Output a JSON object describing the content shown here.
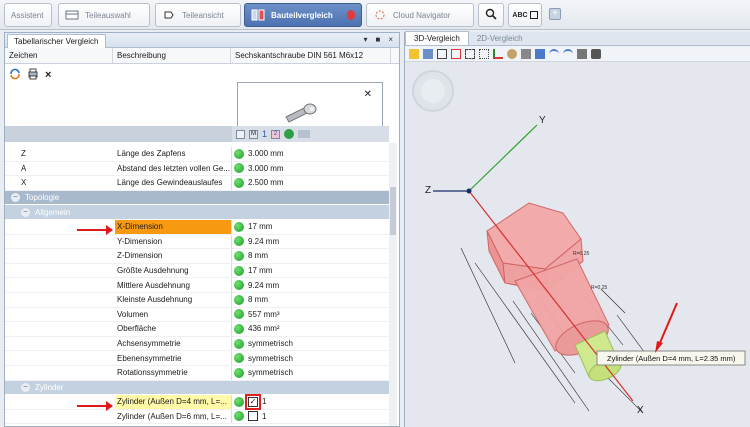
{
  "tabs": [
    {
      "label": "Assistent",
      "icon": "wizard-icon"
    },
    {
      "label": "Teileauswahl",
      "icon": "parts-selection-icon"
    },
    {
      "label": "Teileansicht",
      "icon": "parts-view-icon"
    },
    {
      "label": "Bauteilvergleich",
      "icon": "part-compare-icon",
      "active": true
    },
    {
      "label": "Cloud Navigator",
      "icon": "cloud-navigator-icon"
    }
  ],
  "toolbar": {
    "abc_label": "ABC"
  },
  "left_panel": {
    "title": "Tabellarischer Vergleich",
    "columns": {
      "sign": "Zeichen",
      "description": "Beschreibung",
      "part": "Sechskantschraube DIN 561 M6x12"
    },
    "grid_toolbar": {
      "num1": "1",
      "num2": "2",
      "m_label": "M"
    },
    "rows_top": [
      {
        "sign": "Z",
        "desc": "Länge des Zapfens",
        "value": "3.000 mm"
      },
      {
        "sign": "A",
        "desc": "Abstand des letzten vollen Ge...",
        "value": "3.000 mm"
      },
      {
        "sign": "X",
        "desc": "Länge des Gewindeauslaufes",
        "value": "2.500 mm"
      }
    ],
    "group_topologie": "Topologie",
    "subgroup_allgemein": "Allgemein",
    "rows_allgemein": [
      {
        "desc": "X-Dimension",
        "value": "17 mm"
      },
      {
        "desc": "Y-Dimension",
        "value": "9.24 mm"
      },
      {
        "desc": "Z-Dimension",
        "value": "8 mm"
      },
      {
        "desc": "Größte Ausdehnung",
        "value": "17 mm"
      },
      {
        "desc": "Mittlere Ausdehnung",
        "value": "9.24 mm"
      },
      {
        "desc": "Kleinste Ausdehnung",
        "value": "8 mm"
      },
      {
        "desc": "Volumen",
        "value": "557 mm³"
      },
      {
        "desc": "Oberfläche",
        "value": "436 mm²"
      },
      {
        "desc": "Achsensymmetrie",
        "value": "symmetrisch"
      },
      {
        "desc": "Ebenensymmetrie",
        "value": "symmetrisch"
      },
      {
        "desc": "Rotationssymmetrie",
        "value": "symmetrisch"
      }
    ],
    "subgroup_zylinder": "Zylinder",
    "rows_zylinder": [
      {
        "desc": "Zylinder (Außen D=4 mm, L=...",
        "value": "1",
        "checked": true
      },
      {
        "desc": "Zylinder (Außen D=6 mm, L=...",
        "value": "1",
        "checked": false
      }
    ]
  },
  "right_panel": {
    "tabs": [
      {
        "label": "3D-Vergleich",
        "active": true
      },
      {
        "label": "2D-Vergleich",
        "active": false
      }
    ],
    "axes": {
      "x": "X",
      "y": "Y",
      "z": "Z"
    },
    "tooltip": "Zylinder (Außen D=4 mm, L=2.35 mm)",
    "dim_labels": [
      "R=0.25",
      "R=0.25",
      "X"
    ]
  },
  "colors": {
    "accent": "#4d72b0",
    "selected": "#f79a12",
    "highlight": "#fff9a8",
    "group": "#a8b9cd",
    "arrow": "#e01818"
  }
}
